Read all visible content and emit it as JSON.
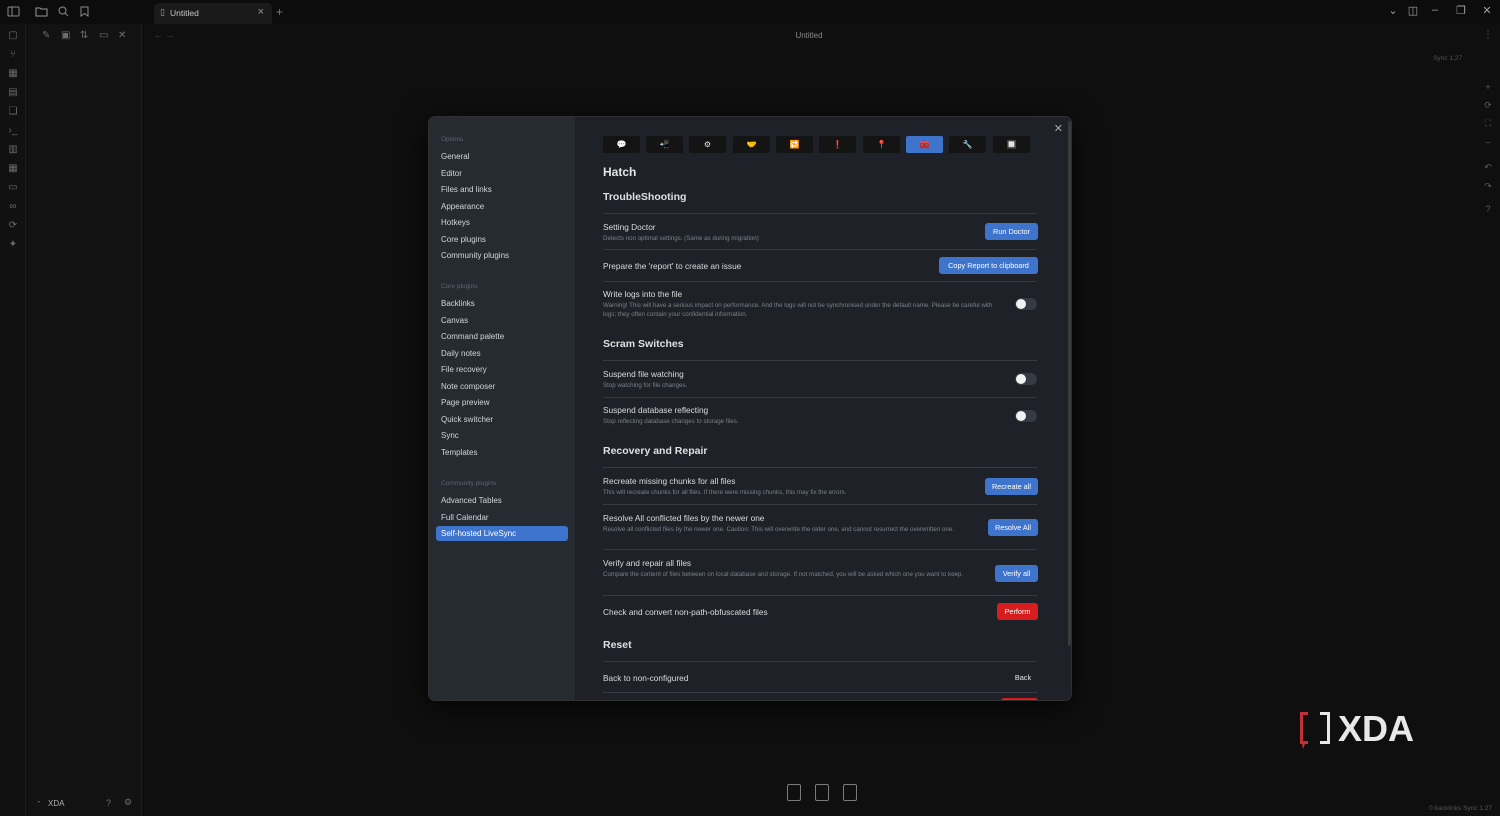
{
  "titlebar": {
    "tab_title": "Untitled",
    "new_tab": "+"
  },
  "editor": {
    "title": "Untitled",
    "sync_status": "Sync 1.27",
    "status_bar": "0 backlinks   Sync 1.27"
  },
  "vault": {
    "name": "XDA"
  },
  "settings_nav": {
    "options_header": "Options",
    "options": [
      "General",
      "Editor",
      "Files and links",
      "Appearance",
      "Hotkeys",
      "Core plugins",
      "Community plugins"
    ],
    "core_header": "Core plugins",
    "core": [
      "Backlinks",
      "Canvas",
      "Command palette",
      "Daily notes",
      "File recovery",
      "Note composer",
      "Page preview",
      "Quick switcher",
      "Sync",
      "Templates"
    ],
    "community_header": "Community plugins",
    "community": [
      "Advanced Tables",
      "Full Calendar",
      "Self-hosted LiveSync"
    ],
    "active": "Self-hosted LiveSync"
  },
  "plugin_tabs": [
    {
      "icon": "speech-bubble-icon",
      "glyph": "💬"
    },
    {
      "icon": "upload-icon",
      "glyph": "📲"
    },
    {
      "icon": "gear-icon",
      "glyph": "⚙"
    },
    {
      "icon": "handshake-icon",
      "glyph": "🤝"
    },
    {
      "icon": "sync-icon",
      "glyph": "🔁"
    },
    {
      "icon": "exclamation-icon",
      "glyph": "❗"
    },
    {
      "icon": "pin-icon",
      "glyph": "📍"
    },
    {
      "icon": "medkit-icon",
      "glyph": "🧰"
    },
    {
      "icon": "wrench-icon",
      "glyph": "🔧"
    },
    {
      "icon": "grid-icon",
      "glyph": "🔲"
    }
  ],
  "content": {
    "page_title": "Hatch",
    "troubleshooting": {
      "heading": "TroubleShooting",
      "setting_doctor": {
        "name": "Setting Doctor",
        "desc": "Detects non optimal settings. (Same as during migration)",
        "button": "Run Doctor"
      },
      "report": {
        "name": "Prepare the 'report' to create an issue",
        "button": "Copy Report to clipboard"
      },
      "write_logs": {
        "name": "Write logs into the file",
        "desc": "Warning! This will have a serious impact on performance. And the logs will not be synchronised under the default name. Please be careful with logs; they often contain your confidential information."
      }
    },
    "scram": {
      "heading": "Scram Switches",
      "suspend_watching": {
        "name": "Suspend file watching",
        "desc": "Stop watching for file changes."
      },
      "suspend_reflecting": {
        "name": "Suspend database reflecting",
        "desc": "Stop reflecting database changes to storage files."
      }
    },
    "recovery": {
      "heading": "Recovery and Repair",
      "recreate": {
        "name": "Recreate missing chunks for all files",
        "desc": "This will recreate chunks for all files. If there were missing chunks, this may fix the errors.",
        "button": "Recreate all"
      },
      "resolve": {
        "name": "Resolve All conflicted files by the newer one",
        "desc": "Resolve all conflicted files by the newer one. Caution: This will overwrite the older one, and cannot resurrect the overwritten one.",
        "button": "Resolve All"
      },
      "verify": {
        "name": "Verify and repair all files",
        "desc": "Compare the content of files between on local database and storage. If not matched, you will be asked which one you want to keep.",
        "button": "Verify all"
      },
      "convert": {
        "name": "Check and convert non-path-obfuscated files",
        "button": "Perform"
      }
    },
    "reset": {
      "heading": "Reset",
      "back": {
        "name": "Back to non-configured",
        "button": "Back"
      }
    }
  },
  "toggles": {
    "write_logs": false,
    "suspend_watching": false,
    "suspend_reflecting": false
  },
  "colors": {
    "accent": "#3f74cc",
    "danger": "#d71d1d",
    "watermark_red": "#c2303a",
    "watermark_white": "#e8e8e8"
  },
  "watermark": {
    "text": "XDA"
  }
}
